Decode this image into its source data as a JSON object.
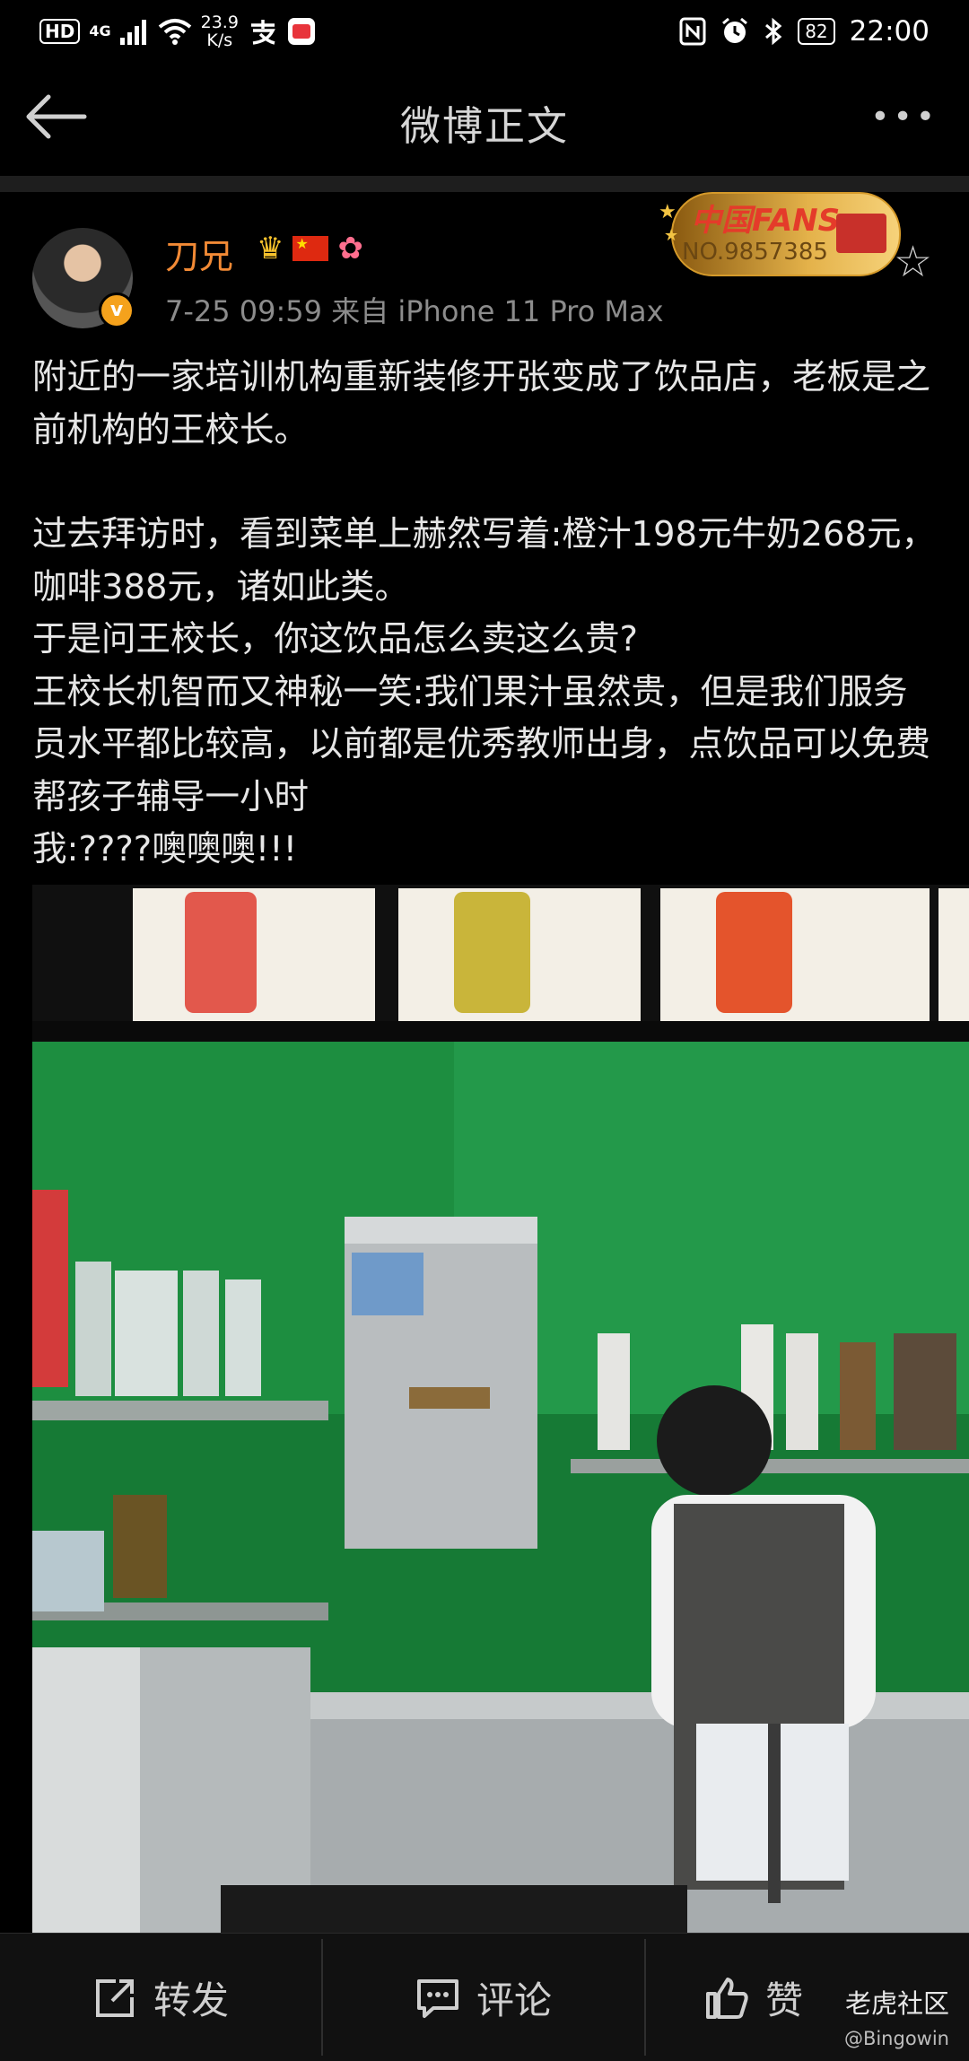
{
  "status_bar": {
    "hd": "HD",
    "network": "4G",
    "speed_value": "23.9",
    "speed_unit": "K/s",
    "battery": "82",
    "time": "22:00"
  },
  "nav": {
    "title": "微博正文",
    "more": "•••"
  },
  "post": {
    "username": "刀兄",
    "meta": "7-25 09:59   来自 iPhone 11 Pro Max",
    "fans_badge": {
      "title": "中国FANS",
      "number": "NO.9857385"
    },
    "paragraphs": [
      "附近的一家培训机构重新装修开张变成了饮品店，老板是之前机构的王校长。",
      "",
      "过去拜访时，看到菜单上赫然写着:橙汁198元牛奶268元，咖啡388元，诸如此类。",
      "于是问王校长，你这饮品怎么卖这么贵?",
      "王校长机智而又神秘一笑:我们果汁虽然贵，但是我们服务员水平都比较高，以前都是优秀教师出身，点饮品可以免费帮孩子辅导一小时",
      "我:????噢噢噢!!!"
    ]
  },
  "bottom_bar": {
    "repost_label": "转发",
    "comment_label": "评论",
    "like_label": "赞"
  },
  "watermark": {
    "site": "老虎社区",
    "user": "@Bingowin"
  },
  "colors": {
    "username": "#f28a35",
    "background": "#000000",
    "wall_green": "#1f8a3c"
  },
  "icons": [
    "back-arrow-icon",
    "more-icon",
    "verified-icon",
    "crown-icon",
    "flag-icon",
    "star-icon",
    "repost-icon",
    "comment-icon",
    "like-icon"
  ]
}
